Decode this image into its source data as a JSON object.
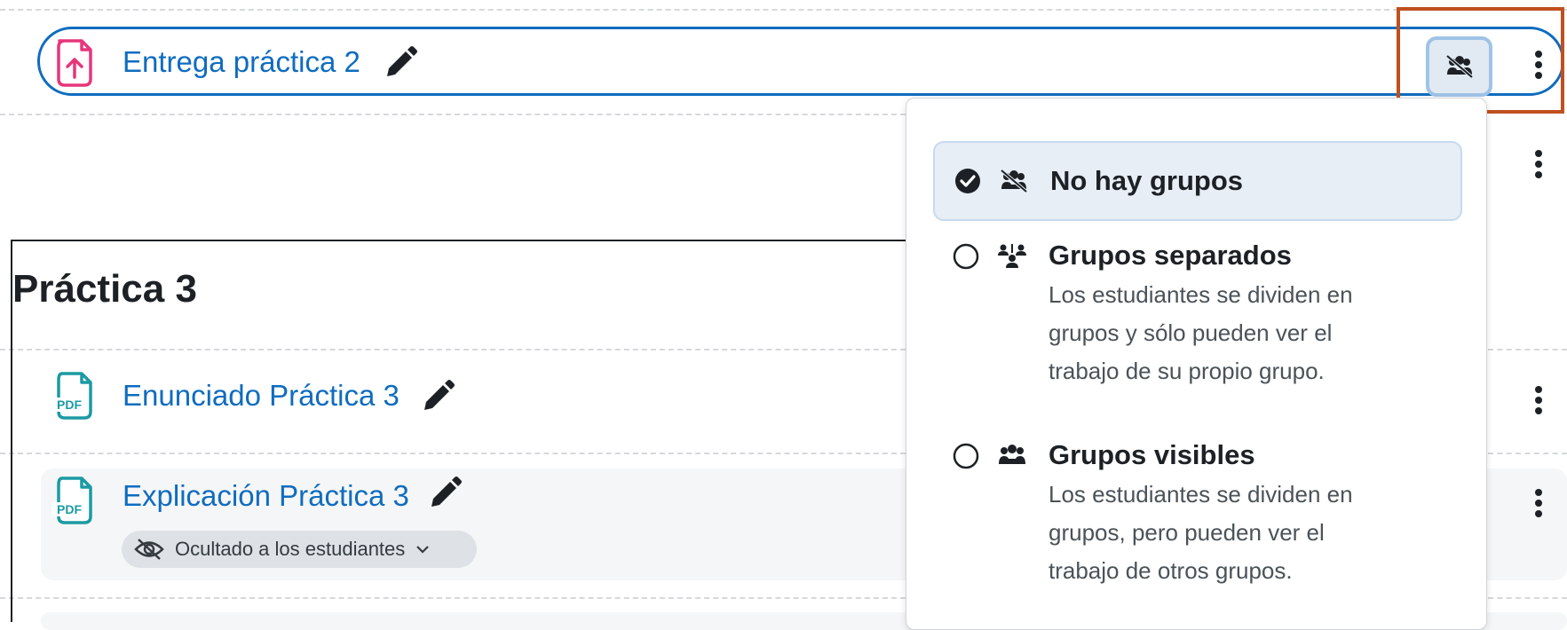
{
  "activities": [
    {
      "title": "Entrega práctica 2",
      "icon": "assignment-upload-icon"
    },
    {
      "title": "Enunciado Práctica 3",
      "icon": "pdf-file-icon"
    },
    {
      "title": "Explicación Práctica 3",
      "icon": "pdf-file-icon"
    }
  ],
  "section": {
    "title": "Práctica 3"
  },
  "pdf_icon_text": "PDF",
  "hidden_badge": {
    "label": "Ocultado a los estudiantes",
    "icon": "eye-slash-icon"
  },
  "group_mode_menu": {
    "options": [
      {
        "label": "No hay grupos",
        "selected": true,
        "icon": "no-groups-icon",
        "description": []
      },
      {
        "label": "Grupos separados",
        "selected": false,
        "icon": "separate-groups-icon",
        "description": [
          "Los estudiantes se dividen en",
          "grupos y sólo pueden ver el",
          "trabajo de su propio grupo."
        ]
      },
      {
        "label": "Grupos visibles",
        "selected": false,
        "icon": "visible-groups-icon",
        "description": [
          "Los estudiantes se dividen en",
          "grupos, pero pueden ver el",
          "trabajo de otros grupos."
        ]
      }
    ]
  },
  "colors": {
    "link": "#0f6cbf",
    "assignment_icon": "#e7357b",
    "pdf_icon": "#1b9aa3",
    "annotation": "#c0501f",
    "selected_bg": "#e7eef6"
  }
}
